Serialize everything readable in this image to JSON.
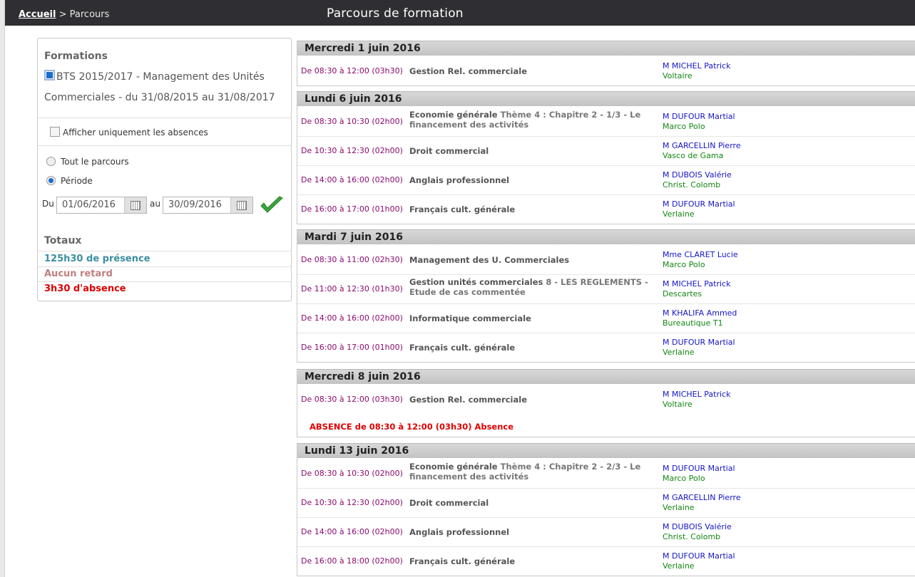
{
  "breadcrumb": {
    "home": "Accueil",
    "sep": " > ",
    "current": "Parcours"
  },
  "page_title": "Parcours de formation",
  "left": {
    "formations_title": "Formations",
    "formation_label": "BTS 2015/2017 - Management des Unités Commerciales - du 31/08/2015 au 31/08/2017",
    "absences_only_label": "Afficher uniquement les absences",
    "radio_all_label": "Tout le parcours",
    "radio_period_label": "Période",
    "du_label": "Du",
    "au_label": "au",
    "date_from": "01/06/2016",
    "date_to": "30/09/2016",
    "totaux_title": "Totaux",
    "presence": "125h30 de présence",
    "retard": "Aucun retard",
    "absence": "3h30 d'absence"
  },
  "colors": {
    "time": "#8b0a6e",
    "teacher": "#1515c8",
    "room": "#138613",
    "presence": "#3a8fa0",
    "retard": "#c08080",
    "absence": "#e00000",
    "check": "#3aa53a"
  },
  "days": [
    {
      "date": "Mercredi 1 juin 2016",
      "sessions": [
        {
          "time": "De 08:30 à 12:00 (03h30)",
          "subject": "Gestion Rel. commerciale",
          "extra": "",
          "teacher": "M MICHEL Patrick",
          "room": "Voltaire"
        }
      ]
    },
    {
      "date": "Lundi 6 juin 2016",
      "sessions": [
        {
          "time": "De 08:30 à 10:30 (02h00)",
          "subject": "Economie générale",
          "extra": "Thème 4 : Chapitre 2 - 1/3 - Le financement des activités",
          "teacher": "M DUFOUR Martial",
          "room": "Marco Polo"
        },
        {
          "time": "De 10:30 à 12:30 (02h00)",
          "subject": "Droit commercial",
          "extra": "",
          "teacher": "M GARCELLIN Pierre",
          "room": "Vasco de Gama"
        },
        {
          "time": "De 14:00 à 16:00 (02h00)",
          "subject": "Anglais professionnel",
          "extra": "",
          "teacher": "M DUBOIS Valérie",
          "room": "Christ. Colomb"
        },
        {
          "time": "De 16:00 à 17:00 (01h00)",
          "subject": "Français cult. générale",
          "extra": "",
          "teacher": "M DUFOUR Martial",
          "room": "Verlaine"
        }
      ]
    },
    {
      "date": "Mardi 7 juin 2016",
      "sessions": [
        {
          "time": "De 08:30 à 11:00 (02h30)",
          "subject": "Management des U. Commerciales",
          "extra": "",
          "teacher": "Mme CLARET Lucie",
          "room": "Marco Polo"
        },
        {
          "time": "De 11:00 à 12:30 (01h30)",
          "subject": "Gestion unités commerciales",
          "extra": "8 - LES REGLEMENTS - Etude de cas commentée",
          "teacher": "M MICHEL Patrick",
          "room": "Descartes"
        },
        {
          "time": "De 14:00 à 16:00 (02h00)",
          "subject": "Informatique commerciale",
          "extra": "",
          "teacher": "M KHALIFA Ammed",
          "room": "Bureautique T1"
        },
        {
          "time": "De 16:00 à 17:00 (01h00)",
          "subject": "Français cult. générale",
          "extra": "",
          "teacher": "M DUFOUR Martial",
          "room": "Verlaine"
        }
      ]
    },
    {
      "date": "Mercredi 8 juin 2016",
      "sessions": [
        {
          "time": "De 08:30 à 12:00 (03h30)",
          "subject": "Gestion Rel. commerciale",
          "extra": "",
          "teacher": "M MICHEL Patrick",
          "room": "Voltaire",
          "absence": "ABSENCE de 08:30 à 12:00 (03h30) Absence"
        }
      ]
    },
    {
      "date": "Lundi 13 juin 2016",
      "sessions": [
        {
          "time": "De 08:30 à 10:30 (02h00)",
          "subject": "Economie générale",
          "extra": "Thème 4 : Chapitre 2 - 2/3 - Le financement des activités",
          "teacher": "M DUFOUR Martial",
          "room": "Marco Polo"
        },
        {
          "time": "De 10:30 à 12:30 (02h00)",
          "subject": "Droit commercial",
          "extra": "",
          "teacher": "M GARCELLIN Pierre",
          "room": "Verlaine"
        },
        {
          "time": "De 14:00 à 16:00 (02h00)",
          "subject": "Anglais professionnel",
          "extra": "",
          "teacher": "M DUBOIS Valérie",
          "room": "Christ. Colomb"
        },
        {
          "time": "De 16:00 à 18:00 (02h00)",
          "subject": "Français cult. générale",
          "extra": "",
          "teacher": "M DUFOUR Martial",
          "room": "Verlaine"
        }
      ]
    }
  ]
}
